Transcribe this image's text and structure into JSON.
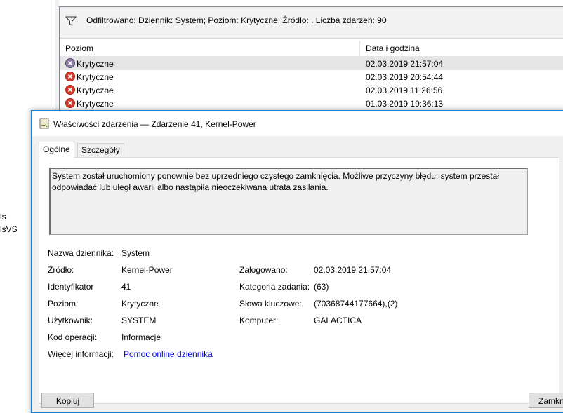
{
  "left_pane": {
    "items": [
      "ls",
      "lsVS"
    ]
  },
  "filter_bar": {
    "icon": "funnel-icon",
    "text": "Odfiltrowano: Dziennik: System; Poziom: Krytyczne; Źródło: . Liczba zdarzeń: 90"
  },
  "table": {
    "columns": [
      "Poziom",
      "Data i godzina"
    ],
    "rows": [
      {
        "level": "Krytyczne",
        "datetime": "02.03.2019 21:57:04"
      },
      {
        "level": "Krytyczne",
        "datetime": "02.03.2019 20:54:44"
      },
      {
        "level": "Krytyczne",
        "datetime": "02.03.2019 11:26:56"
      },
      {
        "level": "Krytyczne",
        "datetime": "01.03.2019 19:36:13"
      }
    ]
  },
  "dialog": {
    "title": "Właściwości zdarzenia — Zdarzenie 41, Kernel-Power",
    "tabs": [
      "Ogólne",
      "Szczegóły"
    ],
    "description": "System został uruchomiony ponownie bez uprzedniego czystego zamknięcia. Możliwe przyczyny błędu: system przestał\nodpowiadać lub uległ awarii albo nastąpiła nieoczekiwana utrata zasilania.",
    "fields": {
      "log_name_label": "Nazwa dziennika:",
      "log_name": "System",
      "source_label": "Źródło:",
      "source": "Kernel-Power",
      "logged_label": "Zalogowano:",
      "logged": "02.03.2019 21:57:04",
      "id_label": "Identyfikator",
      "id": "41",
      "task_label": "Kategoria zadania:",
      "task": "(63)",
      "level_label": "Poziom:",
      "level": "Krytyczne",
      "keywords_label": "Słowa kluczowe:",
      "keywords": "(70368744177664),(2)",
      "user_label": "Użytkownik:",
      "user": "SYSTEM",
      "computer_label": "Komputer:",
      "computer": "GALACTICA",
      "opcode_label": "Kod operacji:",
      "opcode": "Informacje",
      "more_label": "Więcej informacji:",
      "more_link": "Pomoc online dziennika"
    },
    "buttons": {
      "copy": "Kopiuj",
      "close": "Zamkn"
    }
  },
  "colors": {
    "accent": "#1883d7",
    "error": "#c42b1c",
    "link": "#0000ee"
  }
}
